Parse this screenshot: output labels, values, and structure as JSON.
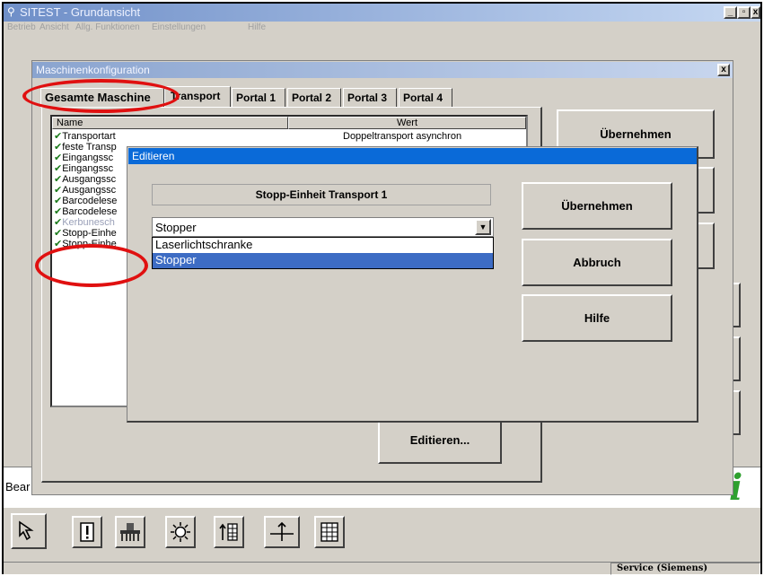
{
  "app": {
    "title": "SITEST - Grundansicht",
    "menu": [
      "Betrieb",
      "Ansicht",
      "Allg. Funktionen",
      "Einstellungen",
      "Hilfe"
    ],
    "window_buttons": [
      "_",
      "▫",
      "x"
    ],
    "left_label": "Bear",
    "status_user": "Service (Siemens)",
    "info_letter": "i"
  },
  "config_dialog": {
    "title": "Maschinenkonfiguration",
    "close": "x",
    "tabs": [
      "Gesamte Maschine",
      "Transport",
      "Portal 1",
      "Portal 2",
      "Portal 3",
      "Portal 4"
    ],
    "list_headers": {
      "name": "Name",
      "value": "Wert"
    },
    "rows": [
      {
        "name": "Transportart",
        "value": "Doppeltransport asynchron"
      },
      {
        "name": "feste Transp",
        "value": ""
      },
      {
        "name": "Eingangssc",
        "value": ""
      },
      {
        "name": "Eingangssc",
        "value": ""
      },
      {
        "name": "Ausgangssc",
        "value": ""
      },
      {
        "name": "Ausgangssc",
        "value": ""
      },
      {
        "name": "Barcodelese",
        "value": ""
      },
      {
        "name": "Barcodelese",
        "value": ""
      },
      {
        "name": "Kerbunesch",
        "value": ""
      },
      {
        "name": "Stopp-Einhe",
        "value": ""
      },
      {
        "name": "Stopp-Einhe",
        "value": ""
      }
    ],
    "apply_button": "Übernehmen",
    "edit_button": "Editieren..."
  },
  "edit_dialog": {
    "title": "Editieren",
    "field_label": "Stopp-Einheit Transport 1",
    "selected_value": "Stopper",
    "options": [
      "Laserlichtschranke",
      "Stopper"
    ],
    "selected_index": 1,
    "buttons": {
      "apply": "Übernehmen",
      "cancel": "Abbruch",
      "help": "Hilfe"
    }
  },
  "toolbar": [
    "pointer-icon",
    "exclamation-icon",
    "machine-icon",
    "sun-icon",
    "feeder-icon",
    "axis-icon",
    "grid-icon"
  ],
  "colors": {
    "accent": "#0a246a",
    "highlight": "#3d6cc4",
    "annotation": "#e01010",
    "check": "#1a7a1a"
  }
}
